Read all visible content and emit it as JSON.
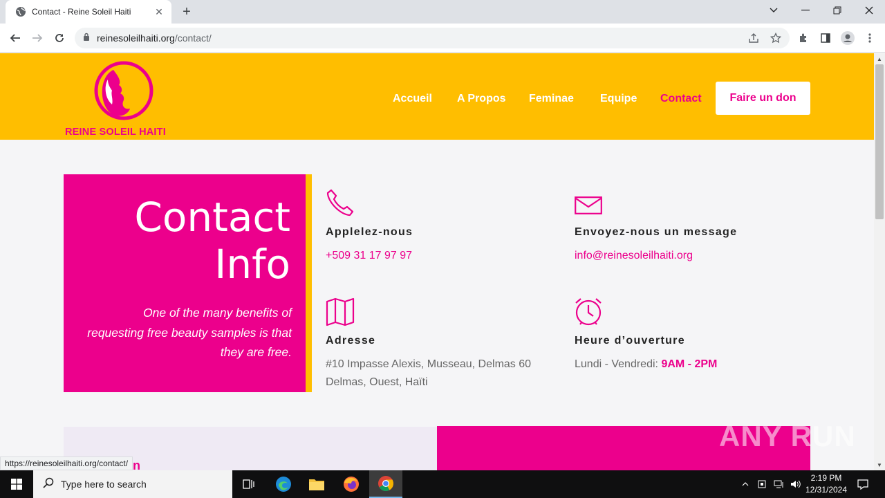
{
  "browser": {
    "tab_title": "Contact - Reine Soleil Haiti",
    "url_host": "reinesoleilhaiti.org",
    "url_path": "/contact/",
    "status_url": "https://reinesoleilhaiti.org/contact/"
  },
  "site": {
    "brand": "REINE SOLEIL HAITI",
    "nav": [
      {
        "label": "Accueil"
      },
      {
        "label": "A Propos"
      },
      {
        "label": "Feminae"
      },
      {
        "label": "Equipe"
      },
      {
        "label": "Contact",
        "active": true
      }
    ],
    "donate_label": "Faire un don",
    "colors": {
      "brand_yellow": "#ffbe00",
      "brand_pink": "#ec008c"
    }
  },
  "contact": {
    "title_line1": "Contact",
    "title_line2": "Info",
    "subtitle": "One of the many benefits of requesting free beauty samples is that they are free.",
    "phone": {
      "label": "Applelez-nous",
      "value": "+509 31 17 97 97",
      "icon": "phone-icon"
    },
    "email": {
      "label": "Envoyez-nous un message",
      "value": "info@reinesoleilhaiti.org",
      "icon": "envelope-icon"
    },
    "address": {
      "label": "Adresse",
      "line1": "#10 Impasse Alexis, Musseau, Delmas 60",
      "line2": "Delmas, Ouest, Haïti",
      "icon": "map-icon"
    },
    "hours": {
      "label": "Heure d’ouverture",
      "days": "Lundi - Vendredi:",
      "time": "9AM - 2PM",
      "icon": "alarm-clock-icon"
    }
  },
  "watermark": "ANY RUN",
  "taskbar": {
    "search_placeholder": "Type here to search",
    "time": "2:19 PM",
    "date": "12/31/2024"
  }
}
